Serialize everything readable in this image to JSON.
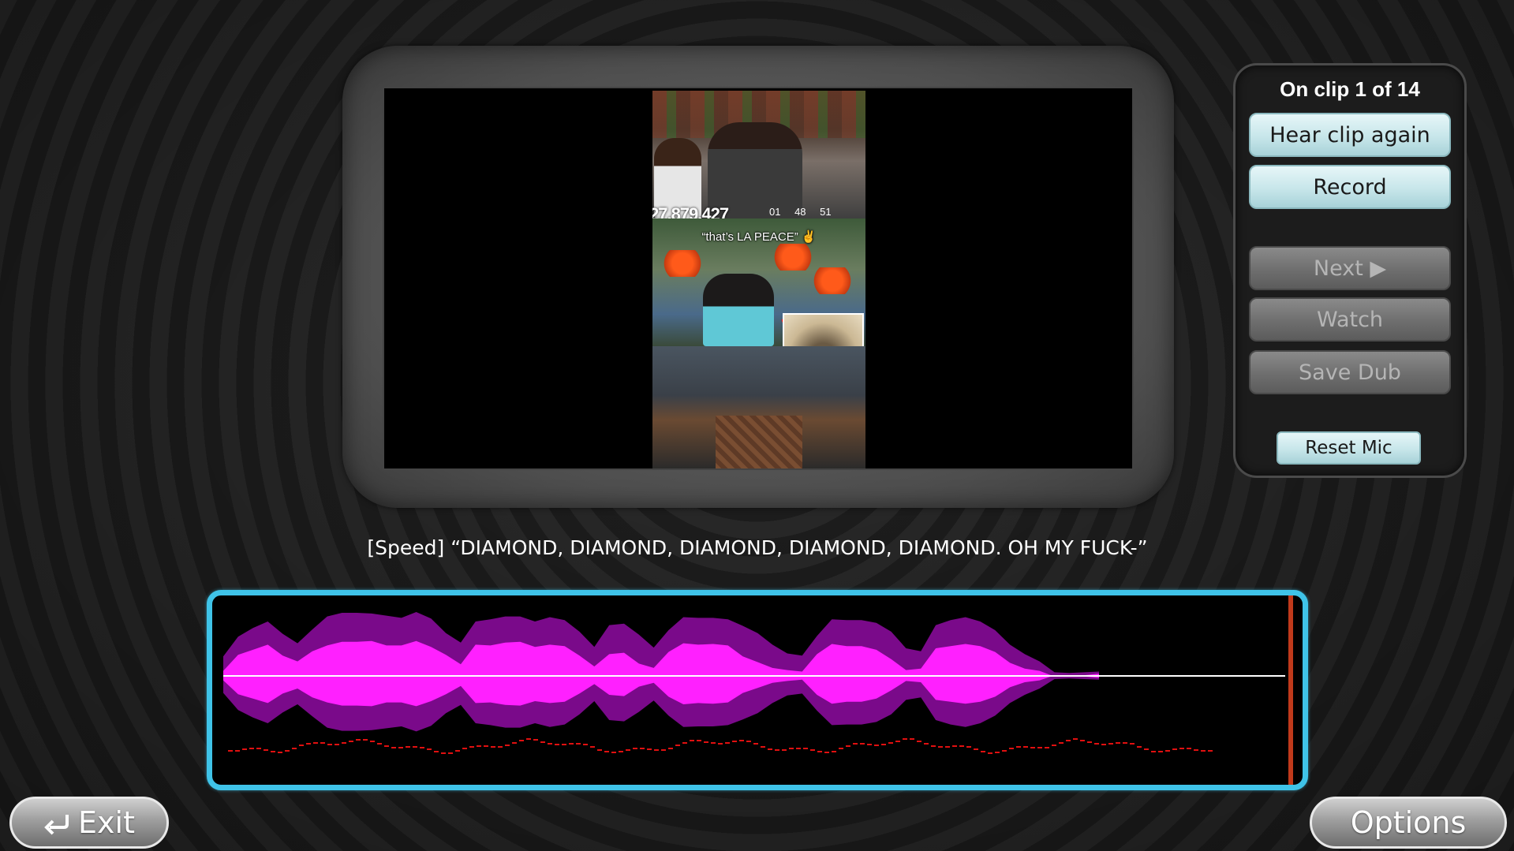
{
  "video": {
    "counter_text": "27,879,427",
    "counter_small": "01 48 51",
    "caption": "“that’s LA PEACE” ✌"
  },
  "controls": {
    "clip_status": "On clip 1 of 14",
    "hear_clip_again": "Hear clip again",
    "record": "Record",
    "next": "Next ▶",
    "watch": "Watch",
    "save_dub": "Save Dub",
    "reset_mic": "Reset Mic"
  },
  "subtitle": "[Speed] “DIAMOND, DIAMOND, DIAMOND, DIAMOND, DIAMOND. OH MY FUCK-”",
  "navigation": {
    "exit": "Exit",
    "options": "Options"
  },
  "colors": {
    "wave_outer": "#7a0a8a",
    "wave_inner": "#ff20ff",
    "wave_frame": "#3fc3e8",
    "pitch_line": "#e01010",
    "playhead": "#c0391b",
    "button_active": "#c7e6ea",
    "button_disabled": "#6e6e6e"
  },
  "waveform": {
    "outer_amplitude": [
      0.3,
      0.55,
      0.65,
      0.72,
      0.6,
      0.45,
      0.62,
      0.85,
      0.88,
      0.86,
      0.83,
      0.85,
      0.8,
      0.86,
      0.82,
      0.6,
      0.45,
      0.72,
      0.8,
      0.82,
      0.8,
      0.78,
      0.82,
      0.76,
      0.58,
      0.42,
      0.7,
      0.7,
      0.6,
      0.4,
      0.62,
      0.78,
      0.82,
      0.8,
      0.76,
      0.72,
      0.6,
      0.42,
      0.28,
      0.3,
      0.55,
      0.76,
      0.8,
      0.78,
      0.72,
      0.58,
      0.4,
      0.34,
      0.68,
      0.8,
      0.82,
      0.74,
      0.6,
      0.45,
      0.3,
      0.18,
      0.08,
      0.05,
      0.04,
      0.03
    ],
    "inner_amplitude": [
      0.1,
      0.3,
      0.35,
      0.4,
      0.3,
      0.2,
      0.32,
      0.45,
      0.48,
      0.46,
      0.45,
      0.44,
      0.42,
      0.46,
      0.43,
      0.3,
      0.15,
      0.4,
      0.44,
      0.46,
      0.45,
      0.43,
      0.44,
      0.4,
      0.25,
      0.15,
      0.3,
      0.3,
      0.2,
      0.12,
      0.32,
      0.42,
      0.45,
      0.44,
      0.4,
      0.3,
      0.2,
      0.1,
      0.05,
      0.08,
      0.3,
      0.42,
      0.44,
      0.42,
      0.35,
      0.2,
      0.1,
      0.1,
      0.36,
      0.44,
      0.45,
      0.4,
      0.3,
      0.2,
      0.1,
      0.05,
      0.02,
      0.0,
      0.0,
      0.0
    ]
  }
}
